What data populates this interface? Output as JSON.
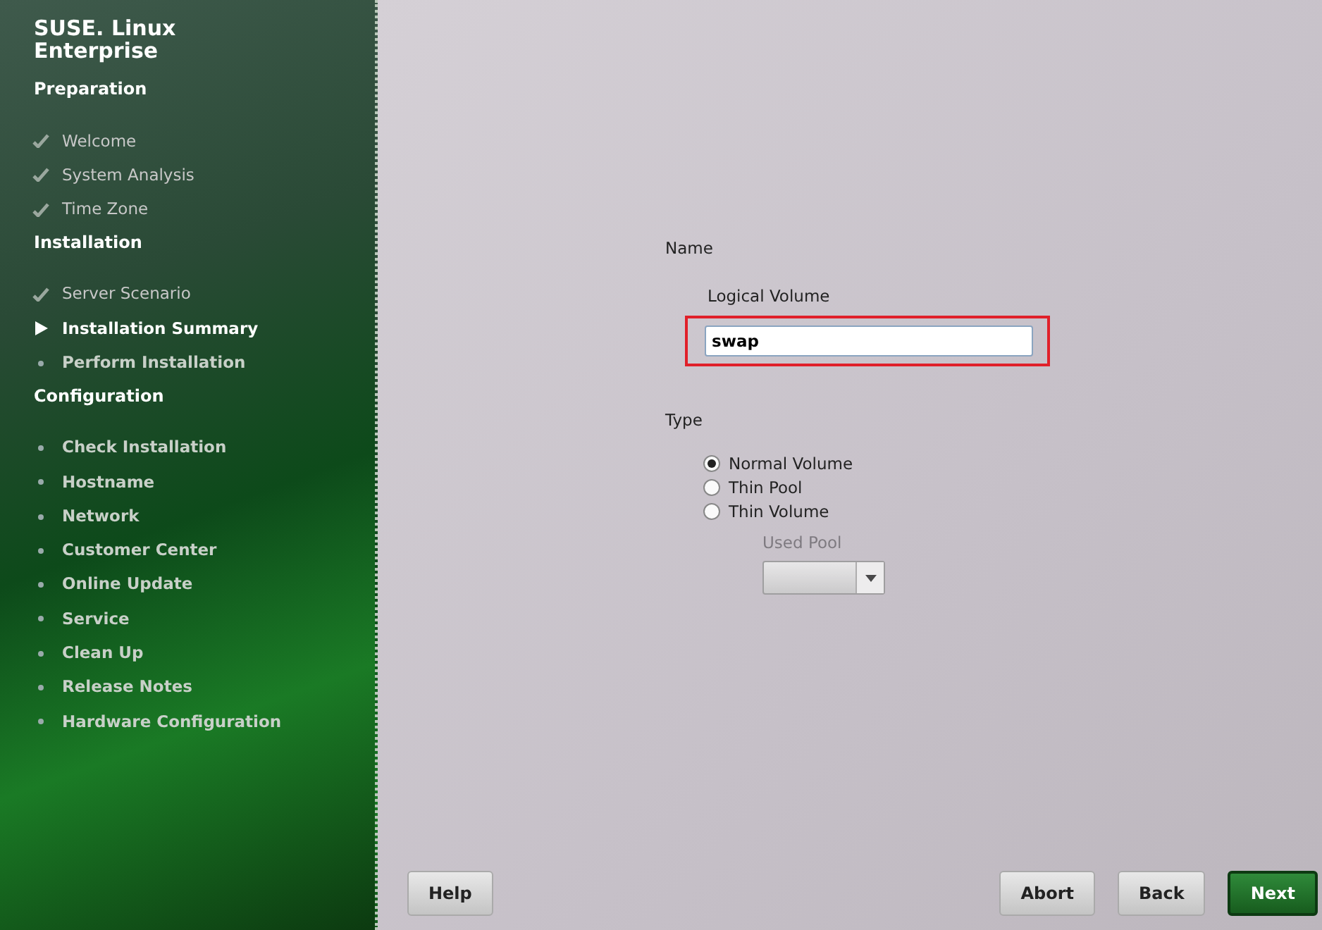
{
  "sidebar": {
    "logo": [
      "SUSE. Linux",
      "Enterprise"
    ],
    "sections": [
      {
        "title": "Preparation",
        "steps": [
          {
            "label": "Welcome",
            "done": true,
            "selected": false
          },
          {
            "label": "System Analysis",
            "done": true,
            "selected": false
          },
          {
            "label": "Time Zone",
            "done": true,
            "selected": false
          }
        ]
      },
      {
        "title": "Installation",
        "steps": [
          {
            "label": "Server Scenario",
            "done": true,
            "selected": false
          },
          {
            "label": "Installation Summary",
            "done": false,
            "selected": true
          },
          {
            "label": "Perform Installation",
            "done": false,
            "selected": false
          }
        ]
      },
      {
        "title": "Configuration",
        "steps": [
          {
            "label": "Check Installation",
            "done": false,
            "selected": false
          },
          {
            "label": "Hostname",
            "done": false,
            "selected": false
          },
          {
            "label": "Network",
            "done": false,
            "selected": false
          },
          {
            "label": "Customer Center",
            "done": false,
            "selected": false
          },
          {
            "label": "Online Update",
            "done": false,
            "selected": false
          },
          {
            "label": "Service",
            "done": false,
            "selected": false
          },
          {
            "label": "Clean Up",
            "done": false,
            "selected": false
          },
          {
            "label": "Release Notes",
            "done": false,
            "selected": false
          },
          {
            "label": "Hardware Configuration",
            "done": false,
            "selected": false
          }
        ]
      }
    ]
  },
  "form": {
    "name_label": "Name",
    "field": {
      "label": "Logical Volume",
      "value": "swap",
      "highlighted": true
    },
    "type_label": "Type",
    "options": [
      {
        "label": "Normal Volume",
        "selected": true
      },
      {
        "label": "Thin Pool",
        "selected": false
      },
      {
        "label": "Thin Volume",
        "selected": false
      }
    ],
    "used_pool": {
      "label": "Used Pool",
      "disabled": true
    }
  },
  "buttons": [
    {
      "label": "Help",
      "kind": "plain"
    },
    {
      "label": "Abort",
      "kind": "plain"
    },
    {
      "label": "Back",
      "kind": "plain"
    },
    {
      "label": "Next",
      "kind": "primary"
    }
  ]
}
